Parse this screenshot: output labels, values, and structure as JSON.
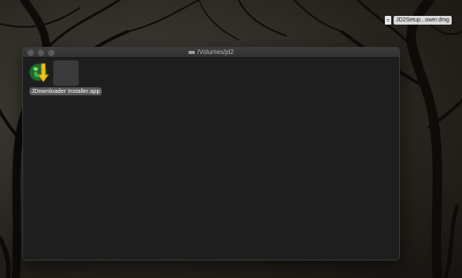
{
  "desktop": {
    "file": {
      "name": "JD2Setup...ower.dmg",
      "icon": "document-icon"
    }
  },
  "window": {
    "title": "/Volumes/jd2",
    "title_icon": "disk-icon",
    "buttons": [
      "close",
      "minimize",
      "zoom"
    ],
    "items": [
      {
        "label": "JDownloader Installer.app",
        "icon": "jdownloader-app-icon"
      }
    ]
  },
  "colors": {
    "window_bg": "#1e1e1e",
    "titlebar": "#353535",
    "selection_label": "#5a5a5a"
  }
}
